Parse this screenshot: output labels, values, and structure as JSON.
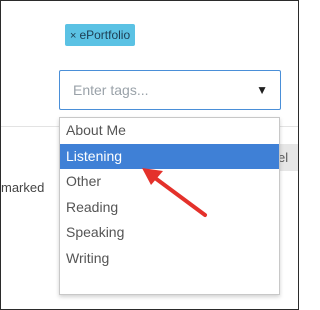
{
  "tag": {
    "remove_glyph": "×",
    "label": "ePortfolio"
  },
  "select": {
    "placeholder": "Enter tags...",
    "caret": "▼"
  },
  "background": {
    "left_text": "marked",
    "right_chip_text": "el"
  },
  "dropdown": {
    "options": [
      "About Me",
      "Listening",
      "Other",
      "Reading",
      "Speaking",
      "Writing"
    ],
    "selected": "Listening"
  },
  "colors": {
    "tag_bg": "#5bc2e4",
    "selected_bg": "#3f80d6",
    "arrow": "#e4312b"
  },
  "annotation": {
    "icon": "red-arrow-icon"
  }
}
